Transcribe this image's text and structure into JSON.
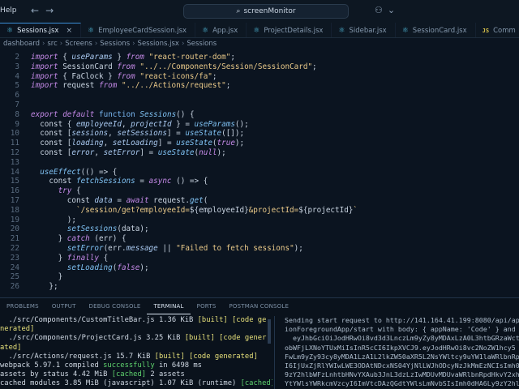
{
  "titlebar": {
    "menu": "Help",
    "back": "←",
    "forward": "→",
    "search": "screenMonitor",
    "right_icons": [
      "copilot-icon",
      "chevron-down-icon"
    ]
  },
  "tabs": [
    {
      "label": "Sessions.jsx",
      "kind": "react",
      "active": true,
      "close": "×"
    },
    {
      "label": "EmployeeCardSession.jsx",
      "kind": "react",
      "active": false
    },
    {
      "label": "App.jsx",
      "kind": "react",
      "active": false
    },
    {
      "label": "ProjectDetails.jsx",
      "kind": "react",
      "active": false
    },
    {
      "label": "Sidebar.jsx",
      "kind": "react",
      "active": false
    },
    {
      "label": "SessionCard.jsx",
      "kind": "react",
      "active": false
    },
    {
      "label": "Comm",
      "kind": "js",
      "active": false
    }
  ],
  "breadcrumb": [
    "dashboard",
    "src",
    "Screens",
    "Sessions",
    "Sessions.jsx",
    "Sessions"
  ],
  "editor": {
    "lines": [
      {
        "n": "2",
        "t": [
          [
            "kw",
            "import"
          ],
          [
            "pun",
            " { "
          ],
          [
            "var",
            "useParams"
          ],
          [
            "pun",
            " } "
          ],
          [
            "kw",
            "from"
          ],
          [
            "str",
            " \"react-router-dom\""
          ],
          [
            "pun",
            ";"
          ]
        ]
      },
      {
        "n": "3",
        "t": [
          [
            "kw",
            "import"
          ],
          [
            "pun",
            " SessionCard "
          ],
          [
            "kw",
            "from"
          ],
          [
            "str",
            " \"../../Components/Session/SessionCard\""
          ],
          [
            "pun",
            ";"
          ]
        ]
      },
      {
        "n": "4",
        "t": [
          [
            "kw",
            "import"
          ],
          [
            "pun",
            " { FaClock } "
          ],
          [
            "kw",
            "from"
          ],
          [
            "str",
            " \"react-icons/fa\""
          ],
          [
            "pun",
            ";"
          ]
        ]
      },
      {
        "n": "5",
        "t": [
          [
            "kw",
            "import"
          ],
          [
            "pun",
            " request "
          ],
          [
            "kw",
            "from"
          ],
          [
            "str",
            " \"../../Actions/request\""
          ],
          [
            "pun",
            ";"
          ]
        ]
      },
      {
        "n": "6",
        "t": []
      },
      {
        "n": "7",
        "t": []
      },
      {
        "n": "8",
        "t": [
          [
            "kw",
            "export"
          ],
          [
            "pun",
            " "
          ],
          [
            "kw",
            "default"
          ],
          [
            "pun",
            " "
          ],
          [
            "kw2",
            "function"
          ],
          [
            "pun",
            " "
          ],
          [
            "fn",
            "Sessions"
          ],
          [
            "pun",
            "() {"
          ]
        ]
      },
      {
        "n": "9",
        "t": [
          [
            "pun",
            "  const { "
          ],
          [
            "var",
            "employeeId"
          ],
          [
            "pun",
            ", "
          ],
          [
            "var",
            "projectId"
          ],
          [
            "pun",
            " } = "
          ],
          [
            "fn",
            "useParams"
          ],
          [
            "pun",
            "();"
          ]
        ]
      },
      {
        "n": "10",
        "t": [
          [
            "pun",
            "  const ["
          ],
          [
            "var",
            "sessions"
          ],
          [
            "pun",
            ", "
          ],
          [
            "var",
            "setSessions"
          ],
          [
            "pun",
            "] = "
          ],
          [
            "fn",
            "useState"
          ],
          [
            "pun",
            "([]);"
          ]
        ]
      },
      {
        "n": "11",
        "t": [
          [
            "pun",
            "  const ["
          ],
          [
            "var",
            "loading"
          ],
          [
            "pun",
            ", "
          ],
          [
            "var",
            "setLoading"
          ],
          [
            "pun",
            "] = "
          ],
          [
            "fn",
            "useState"
          ],
          [
            "pun",
            "("
          ],
          [
            "kw",
            "true"
          ],
          [
            "pun",
            ");"
          ]
        ]
      },
      {
        "n": "12",
        "t": [
          [
            "pun",
            "  const ["
          ],
          [
            "var",
            "error"
          ],
          [
            "pun",
            ", "
          ],
          [
            "var",
            "setError"
          ],
          [
            "pun",
            "] = "
          ],
          [
            "fn",
            "useState"
          ],
          [
            "pun",
            "("
          ],
          [
            "kw",
            "null"
          ],
          [
            "pun",
            ");"
          ]
        ]
      },
      {
        "n": "13",
        "t": []
      },
      {
        "n": "14",
        "t": [
          [
            "fn",
            "  useEffect"
          ],
          [
            "pun",
            "(() => {"
          ]
        ]
      },
      {
        "n": "15",
        "t": [
          [
            "pun",
            "    const "
          ],
          [
            "fn",
            "fetchSessions"
          ],
          [
            "pun",
            " = "
          ],
          [
            "kw",
            "async"
          ],
          [
            "pun",
            " () => {"
          ]
        ]
      },
      {
        "n": "16",
        "t": [
          [
            "kw",
            "      try"
          ],
          [
            "pun",
            " {"
          ]
        ]
      },
      {
        "n": "17",
        "t": [
          [
            "pun",
            "        const "
          ],
          [
            "var",
            "data"
          ],
          [
            "pun",
            " = "
          ],
          [
            "kw",
            "await"
          ],
          [
            "pun",
            " request."
          ],
          [
            "fn",
            "get"
          ],
          [
            "pun",
            "("
          ]
        ]
      },
      {
        "n": "18",
        "t": [
          [
            "str",
            "          `/session/get?employeeId="
          ],
          [
            "pun",
            "${employeeId}"
          ],
          [
            "str",
            "&projectId="
          ],
          [
            "pun",
            "${projectId}"
          ],
          [
            "str",
            "`"
          ]
        ]
      },
      {
        "n": "19",
        "t": [
          [
            "pun",
            "        );"
          ]
        ]
      },
      {
        "n": "20",
        "t": [
          [
            "fn",
            "        setSessions"
          ],
          [
            "pun",
            "(data);"
          ]
        ]
      },
      {
        "n": "21",
        "t": [
          [
            "pun",
            "      } "
          ],
          [
            "kw",
            "catch"
          ],
          [
            "pun",
            " (err) {"
          ]
        ]
      },
      {
        "n": "22",
        "t": [
          [
            "fn",
            "        setError"
          ],
          [
            "pun",
            "(err."
          ],
          [
            "var",
            "message"
          ],
          [
            "pun",
            " || "
          ],
          [
            "str",
            "\"Failed to fetch sessions\""
          ],
          [
            "pun",
            ");"
          ]
        ]
      },
      {
        "n": "23",
        "t": [
          [
            "pun",
            "      } "
          ],
          [
            "kw",
            "finally"
          ],
          [
            "pun",
            " {"
          ]
        ]
      },
      {
        "n": "24",
        "t": [
          [
            "fn",
            "        setLoading"
          ],
          [
            "pun",
            "("
          ],
          [
            "kw",
            "false"
          ],
          [
            "pun",
            ");"
          ]
        ]
      },
      {
        "n": "25",
        "t": [
          [
            "pun",
            "      }"
          ]
        ]
      },
      {
        "n": "26",
        "t": [
          [
            "pun",
            "    };"
          ]
        ]
      }
    ]
  },
  "panel": {
    "tabs": [
      "PROBLEMS",
      "OUTPUT",
      "DEBUG CONSOLE",
      "TERMINAL",
      "PORTS",
      "POSTMAN CONSOLE"
    ],
    "active_tab": "TERMINAL",
    "left_lines": [
      [
        [
          "w",
          "  ./src/Components/CustomTitleBar.js "
        ],
        [
          "w",
          "1.36 KiB "
        ],
        [
          "y",
          "[built] [code ge"
        ]
      ],
      [
        [
          "y",
          "nerated]"
        ]
      ],
      [
        [
          "w",
          "  ./src/Components/ProjectCard.js "
        ],
        [
          "w",
          "3.25 KiB "
        ],
        [
          "y",
          "[built] [code gener"
        ]
      ],
      [
        [
          "y",
          "ated]"
        ]
      ],
      [
        [
          "w",
          "  ./src/Actions/request.js "
        ],
        [
          "w",
          "15.7 KiB "
        ],
        [
          "y",
          "[built] [code generated]"
        ]
      ],
      [
        [
          "w",
          "webpack 5.97.1 compiled "
        ],
        [
          "g",
          "successfully"
        ],
        [
          "w",
          " in 6498 ms"
        ]
      ],
      [
        [
          "w",
          "assets by status 4.42 MiB "
        ],
        [
          "g",
          "[cached]"
        ],
        [
          "w",
          " 2 assets"
        ]
      ],
      [
        [
          "w",
          "cached modules 3.85 MiB (javascript) 1.07 KiB (runtime) "
        ],
        [
          "g",
          "[cached]"
        ]
      ]
    ],
    "right_lines": [
      "Sending start request to http://141.164.41.199:8080/api/ap",
      "ionForegroundApp/start with body: { appName: 'Code' } and",
      "  eyJhbGciOiJodHRwOi8vd3d3LnczLm9yZy8yMDAxLzA0L3htbGRzaWct",
      "obWFjLXNoYTUxMiIsInR5cCI6IkpXVCJ9.eyJodHRwOi8vc2NoZW1hcy5",
      "FwLm9yZy93cy8yMDA1LzA1L2lkZW50aXR5L2NsYWltcy9uYW1laWRlbnRp",
      "I6IjUxZjRlYWIwLWE3ODAtNDcxNS04YjNlLWJhODcyNzJkMmEzNCIsImh0",
      "9zY2hlbWFzLnhtbHNvYXAub3JnL3dzLzIwMDUvMDUvaWRlbnRpdHkvY2xh",
      "YtYWlsYWRkcmVzcyI6ImVtcDAzQGdtYWlsLmNvbSIsImh0dHA6Ly9zY2hl"
    ]
  }
}
